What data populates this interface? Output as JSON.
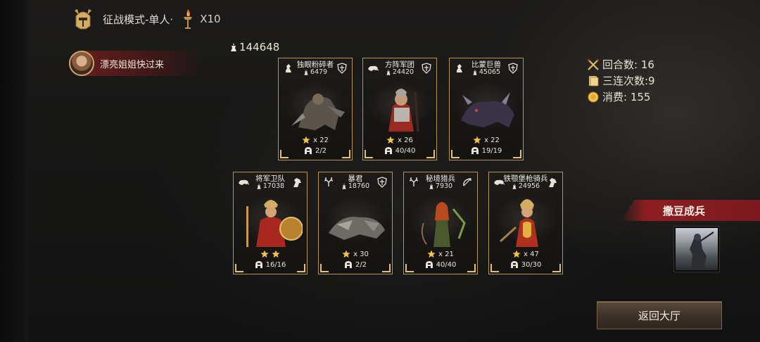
{
  "header": {
    "mode_icon": "helmet-emblem-icon",
    "mode_title": "征战模式-单人·",
    "torch_icon": "torch-icon",
    "multiplier": "X10"
  },
  "player": {
    "name": "漂亮姐姐快过来",
    "avatar_icon": "player-avatar"
  },
  "total_power": "144648",
  "stats": {
    "rounds": "回合数: 16",
    "triple_chains": "三连次数:9",
    "cost": "消费: 155"
  },
  "cards": [
    {
      "name": "独眼粉碎者",
      "power": "6479",
      "stars_text": "x 22",
      "troops": "2/2",
      "left_icon": "chess-knight-icon",
      "right_icon": "shield-crest-icon",
      "art": "armored-ogre"
    },
    {
      "name": "方阵军团",
      "power": "24420",
      "stars_text": "x 26",
      "troops": "40/40",
      "left_icon": "boar-icon",
      "right_icon": "shield-crest-icon",
      "art": "roman-legionary"
    },
    {
      "name": "比蒙巨兽",
      "power": "45065",
      "stars_text": "x 22",
      "troops": "19/19",
      "left_icon": "chess-knight-icon",
      "right_icon": "shield-crest-icon",
      "art": "behemoth-beast"
    },
    {
      "name": "将军卫队",
      "power": "17038",
      "stars_text": "",
      "troops": "16/16",
      "left_icon": "boar-icon",
      "right_icon": "horse-head-icon",
      "art": "general-guard",
      "star_count": 2
    },
    {
      "name": "暴君",
      "power": "18760",
      "stars_text": "x 30",
      "troops": "2/2",
      "left_icon": "antlers-icon",
      "right_icon": "shield-crest-icon",
      "art": "armored-tyrant"
    },
    {
      "name": "秘境猎兵",
      "power": "7930",
      "stars_text": "x 21",
      "troops": "40/40",
      "left_icon": "antlers-icon",
      "right_icon": "bow-arrow-icon",
      "art": "forest-huntress"
    },
    {
      "name": "铁颚堡枪骑兵",
      "power": "24956",
      "stars_text": "x 47",
      "troops": "30/30",
      "left_icon": "boar-icon",
      "right_icon": "horse-head-icon",
      "art": "lancer-warrior"
    }
  ],
  "ability": {
    "label": "撒豆成兵",
    "thumb": "summon-soldier-thumbnail"
  },
  "return_button": "返回大厅"
}
